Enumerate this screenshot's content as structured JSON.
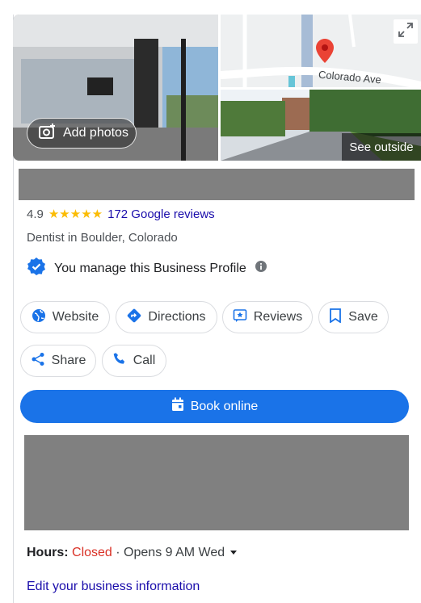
{
  "photos": {
    "add_photos_label": "Add photos",
    "map_street_label": "Colorado Ave",
    "see_outside_label": "See outside"
  },
  "rating": {
    "score": "4.9",
    "stars": "★★★★★",
    "stars_value": 4.9,
    "reviews_link": "172 Google reviews"
  },
  "category": "Dentist in Boulder, Colorado",
  "manage": {
    "text": "You manage this Business Profile"
  },
  "actions": {
    "website": "Website",
    "directions": "Directions",
    "reviews": "Reviews",
    "save": "Save",
    "share": "Share",
    "call": "Call",
    "book_online": "Book online"
  },
  "hours": {
    "label": "Hours:",
    "status": "Closed",
    "next": " · Opens 9 AM Wed"
  },
  "edit_link": "Edit your business information",
  "colors": {
    "accent": "#1a73e8",
    "star": "#fbbc04",
    "closed": "#d93025",
    "link": "#1a0dab",
    "redacted": "#808080"
  }
}
